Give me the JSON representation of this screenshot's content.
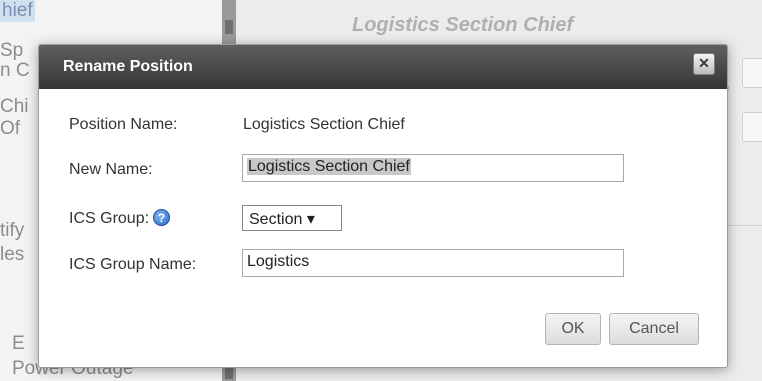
{
  "background": {
    "left_items": [
      "hief",
      "Sp",
      "n C",
      "Chi",
      "Of",
      "tify",
      "les",
      "E",
      "Power Outage"
    ],
    "section_title": "Logistics Section Chief",
    "close_text": "close"
  },
  "dialog": {
    "title": "Rename Position",
    "close_symbol": "✕",
    "position_name_label": "Position Name:",
    "position_name_value": "Logistics Section Chief",
    "new_name_label": "New Name:",
    "new_name_value": "Logistics Section Chief",
    "ics_group_label": "ICS Group:",
    "help_symbol": "?",
    "ics_group_value": "Section ▾",
    "ics_group_name_label": "ICS Group Name:",
    "ics_group_name_value": "Logistics",
    "ok_label": "OK",
    "cancel_label": "Cancel"
  },
  "colors": {
    "titlebar": "#454545",
    "help_icon": "#2c6ac8"
  }
}
